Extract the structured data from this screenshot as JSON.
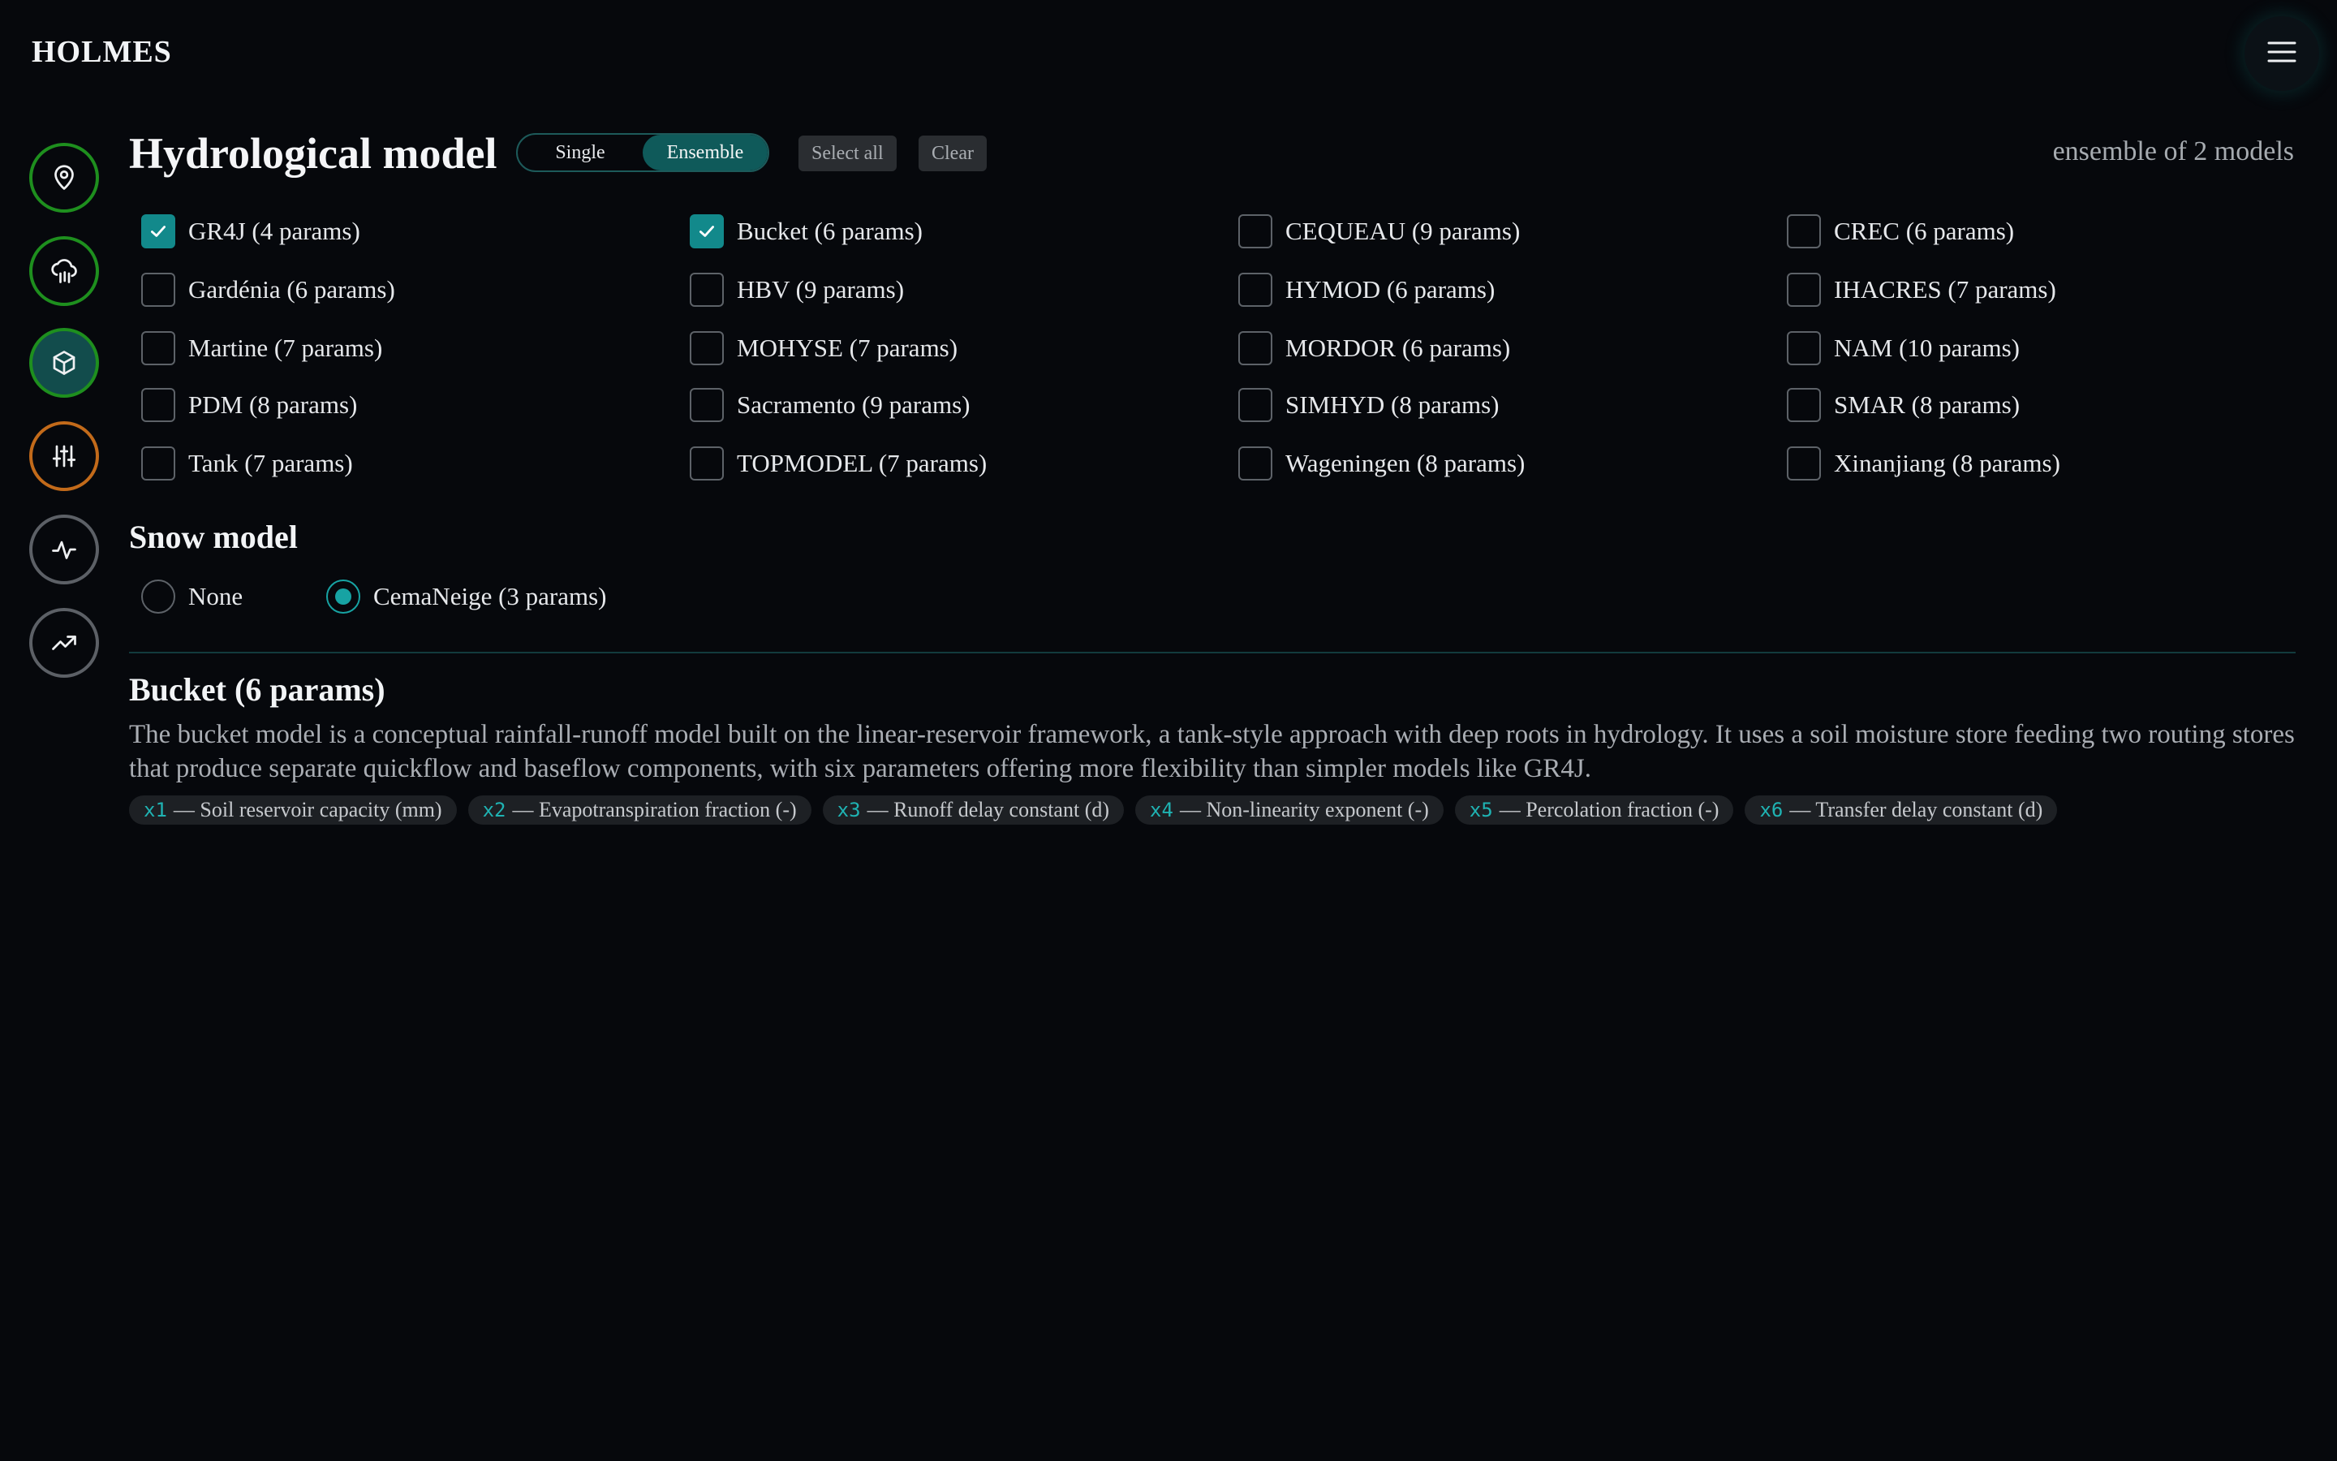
{
  "app": {
    "brand": "HOLMES"
  },
  "header": {
    "menu_icon": "hamburger-icon"
  },
  "rail": [
    {
      "name": "location",
      "icon": "map-pin-icon"
    },
    {
      "name": "weather",
      "icon": "cloud-rain-icon"
    },
    {
      "name": "model",
      "icon": "cube-icon",
      "active": true
    },
    {
      "name": "calibration",
      "icon": "sliders-icon"
    },
    {
      "name": "simulation",
      "icon": "activity-icon"
    },
    {
      "name": "projection",
      "icon": "trending-up-icon"
    }
  ],
  "hydro": {
    "title": "Hydrological model",
    "mode_single": "Single",
    "mode_ensemble": "Ensemble",
    "mode_selected": "Ensemble",
    "select_all": "Select all",
    "clear": "Clear",
    "ensemble_count": "ensemble of 2 models",
    "models": [
      {
        "label": "GR4J (4 params)",
        "checked": true
      },
      {
        "label": "Bucket (6 params)",
        "checked": true
      },
      {
        "label": "CEQUEAU (9 params)",
        "checked": false
      },
      {
        "label": "CREC (6 params)",
        "checked": false
      },
      {
        "label": "Gardénia (6 params)",
        "checked": false
      },
      {
        "label": "HBV (9 params)",
        "checked": false
      },
      {
        "label": "HYMOD (6 params)",
        "checked": false
      },
      {
        "label": "IHACRES (7 params)",
        "checked": false
      },
      {
        "label": "Martine (7 params)",
        "checked": false
      },
      {
        "label": "MOHYSE (7 params)",
        "checked": false
      },
      {
        "label": "MORDOR (6 params)",
        "checked": false
      },
      {
        "label": "NAM (10 params)",
        "checked": false
      },
      {
        "label": "PDM (8 params)",
        "checked": false
      },
      {
        "label": "Sacramento (9 params)",
        "checked": false
      },
      {
        "label": "SIMHYD (8 params)",
        "checked": false
      },
      {
        "label": "SMAR (8 params)",
        "checked": false
      },
      {
        "label": "Tank (7 params)",
        "checked": false
      },
      {
        "label": "TOPMODEL (7 params)",
        "checked": false
      },
      {
        "label": "Wageningen (8 params)",
        "checked": false
      },
      {
        "label": "Xinanjiang (8 params)",
        "checked": false
      }
    ]
  },
  "snow": {
    "title": "Snow model",
    "options": [
      {
        "label": "None",
        "checked": false
      },
      {
        "label": "CemaNeige (3 params)",
        "checked": true
      }
    ]
  },
  "detail": {
    "title": "Bucket (6 params)",
    "description": "The bucket model is a conceptual rainfall-runoff model built on the linear-reservoir framework, a tank-style approach with deep roots in hydrology. It uses a soil moisture store feeding two routing stores that produce separate quickflow and baseflow components, with six parameters offering more flexibility than simpler models like GR4J.",
    "params": [
      {
        "code": "x1",
        "text": "— Soil reservoir capacity (mm)"
      },
      {
        "code": "x2",
        "text": "— Evapotranspiration fraction (-)"
      },
      {
        "code": "x3",
        "text": "— Runoff delay constant (d)"
      },
      {
        "code": "x4",
        "text": "— Non-linearity exponent (-)"
      },
      {
        "code": "x5",
        "text": "— Percolation fraction (-)"
      },
      {
        "code": "x6",
        "text": "— Transfer delay constant (d)"
      }
    ]
  },
  "colors": {
    "accent": "#12898b",
    "rail_green": "#1e8f1e",
    "rail_orange": "#c26a1a",
    "rail_grey": "#5c6066",
    "background": "#06080c"
  }
}
